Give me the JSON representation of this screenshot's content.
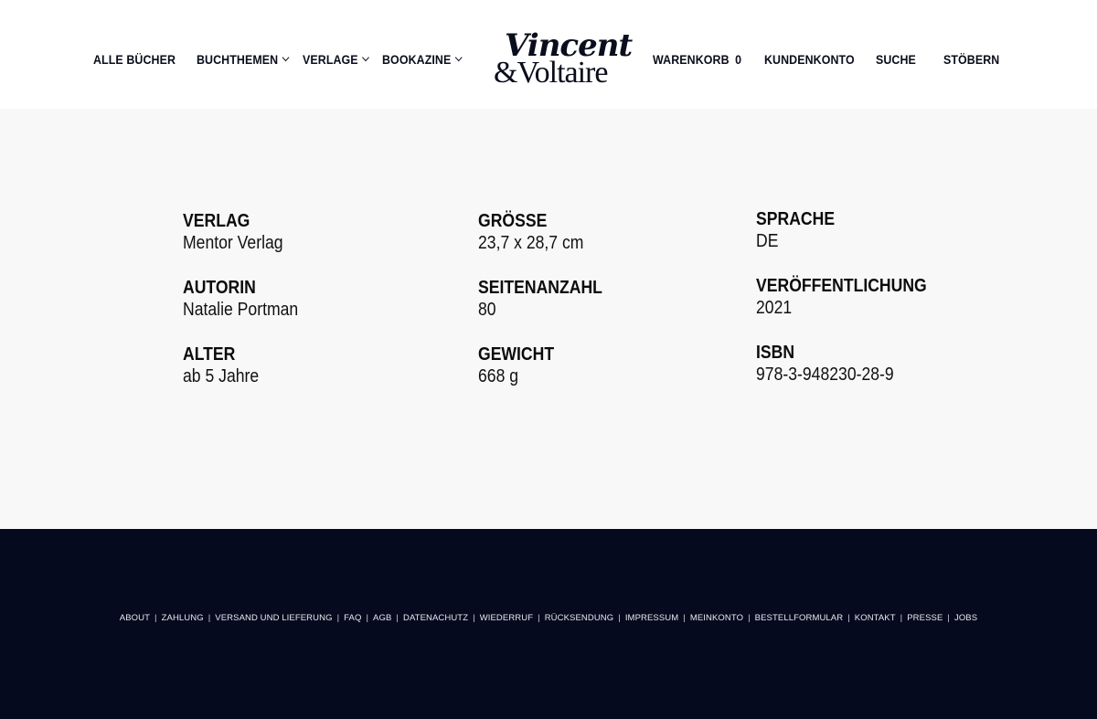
{
  "nav": {
    "left": [
      {
        "label": "ALLE BÜCHER",
        "has_dropdown": false
      },
      {
        "label": "BUCHTHEMEN",
        "has_dropdown": true
      },
      {
        "label": "VERLAGE",
        "has_dropdown": true
      },
      {
        "label": "BOOKAZINE",
        "has_dropdown": true
      }
    ],
    "cart_label": "WARENKORB",
    "cart_count": "0",
    "right": [
      {
        "label": "KUNDENKONTO"
      },
      {
        "label": "SUCHE"
      },
      {
        "label": "STÖBERN"
      }
    ]
  },
  "logo": {
    "line1": "Vincent",
    "line2": "&Voltaire"
  },
  "details": [
    {
      "label": "VERLAG",
      "value": "Mentor Verlag"
    },
    {
      "label": "AUTORIN",
      "value": "Natalie Portman"
    },
    {
      "label": "ALTER",
      "value": "ab 5 Jahre"
    },
    {
      "label": "GRÖSSE",
      "value": "23,7 x 28,7 cm"
    },
    {
      "label": "SEITENANZAHL",
      "value": "80"
    },
    {
      "label": "GEWICHT",
      "value": "668 g"
    },
    {
      "label": "SPRACHE",
      "value": "DE"
    },
    {
      "label": "VERÖFFENTLICHUNG",
      "value": "2021"
    },
    {
      "label": "ISBN",
      "value": "978-3-948230-28-9"
    }
  ],
  "footer": {
    "links": [
      "ABOUT",
      "ZAHLUNG",
      "VERSAND UND LIEFERUNG",
      "FAQ",
      "AGB",
      "DATENACHUTZ",
      "WIEDERRUF",
      "RÜCKSENDUNG",
      "IMPRESSUM",
      "MEINKONTO",
      "BESTELLFORMULAR",
      "KONTAKT",
      "PRESSE",
      "JOBS"
    ],
    "separator": "|"
  },
  "colors": {
    "header_bg": "#ffffff",
    "content_bg": "#f8f8f8",
    "footer_bg": "#050a1e",
    "text": "#0a0d1c"
  }
}
